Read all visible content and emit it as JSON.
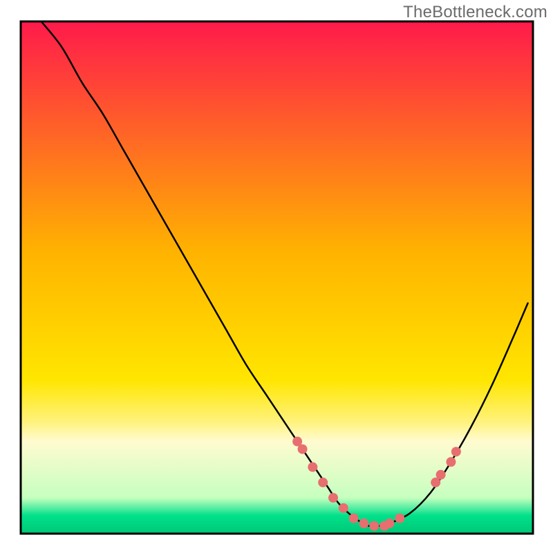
{
  "watermark": "TheBottleneck.com",
  "chart_data": {
    "type": "line",
    "title": "",
    "xlabel": "",
    "ylabel": "",
    "xlim": [
      0,
      100
    ],
    "ylim": [
      0,
      100
    ],
    "grid": false,
    "legend": false,
    "gradient_bands": [
      {
        "stop": 0.0,
        "color": "#ff1a4b"
      },
      {
        "stop": 0.45,
        "color": "#ffb300"
      },
      {
        "stop": 0.7,
        "color": "#ffe600"
      },
      {
        "stop": 0.78,
        "color": "#fff27a"
      },
      {
        "stop": 0.82,
        "color": "#fffbd0"
      },
      {
        "stop": 0.93,
        "color": "#c6ffbf"
      },
      {
        "stop": 0.965,
        "color": "#00e08a"
      },
      {
        "stop": 1.0,
        "color": "#00c878"
      }
    ],
    "curve": {
      "name": "bottleneck-curve",
      "color": "#000000",
      "width": 2.5,
      "x": [
        4,
        8,
        12,
        16,
        20,
        24,
        28,
        32,
        36,
        40,
        44,
        48,
        52,
        56,
        58,
        60,
        62,
        64,
        66,
        68,
        70,
        72,
        76,
        80,
        84,
        88,
        92,
        96,
        99
      ],
      "y": [
        100,
        95,
        88,
        82,
        75,
        68,
        61,
        54,
        47,
        40,
        33,
        27,
        21,
        15,
        12,
        9,
        6,
        4,
        2.5,
        1.5,
        1.5,
        2,
        4,
        8,
        14,
        21,
        29,
        38,
        45
      ]
    },
    "highlight_points": {
      "name": "fit-zone-points",
      "color": "#e76f6f",
      "radius": 7,
      "x": [
        54,
        55,
        57,
        59,
        61,
        63,
        65,
        67,
        69,
        71,
        72,
        74,
        81,
        82,
        84,
        85
      ],
      "y": [
        18,
        16.5,
        13,
        10,
        7,
        5,
        3,
        2,
        1.5,
        1.5,
        2,
        3,
        10,
        11.5,
        14,
        16
      ]
    }
  }
}
